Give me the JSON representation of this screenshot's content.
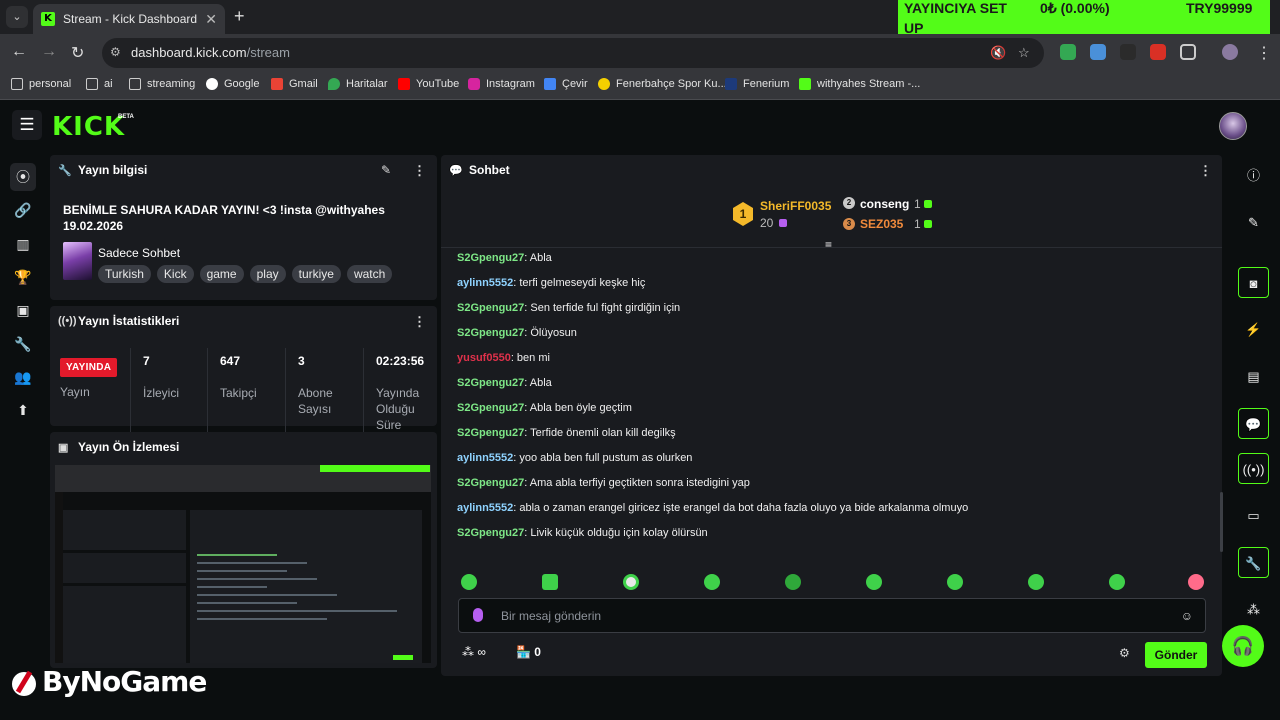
{
  "browser": {
    "tab_title": "Stream - Kick Dashboard",
    "tab_close": "✕",
    "new_tab": "+",
    "url_host": "dashboard.kick.com",
    "url_path": "/stream",
    "banner_1": "YAYINCIYA SET",
    "banner_1b": "UP",
    "banner_2": "0₺ (0.00%)",
    "banner_3": "TRY99999"
  },
  "bookmarks": [
    {
      "label": "personal",
      "icon": "folder-icon"
    },
    {
      "label": "ai",
      "icon": "folder-icon"
    },
    {
      "label": "streaming",
      "icon": "folder-icon"
    },
    {
      "label": "Google",
      "icon": "google-icon"
    },
    {
      "label": "Gmail",
      "icon": "gmail-icon"
    },
    {
      "label": "Haritalar",
      "icon": "maps-icon"
    },
    {
      "label": "YouTube",
      "icon": "youtube-icon"
    },
    {
      "label": "Instagram",
      "icon": "instagram-icon"
    },
    {
      "label": "Çevir",
      "icon": "translate-icon"
    },
    {
      "label": "Fenerbahçe Spor Ku...",
      "icon": "fenerbahce-icon"
    },
    {
      "label": "Fenerium",
      "icon": "fenerium-icon"
    },
    {
      "label": "withyahes Stream -...",
      "icon": "kick-icon"
    }
  ],
  "app": {
    "logo": "KICK",
    "beta": "BETA"
  },
  "stream_info": {
    "header": "Yayın bilgisi",
    "title_line1": "BENİMLE SAHURA KADAR YAYIN! <3 !insta @withyahes",
    "title_line2": "19.02.2026",
    "category": "Sadece Sohbet",
    "tags": [
      "Turkish",
      "Kick",
      "game",
      "play",
      "turkiye",
      "watch"
    ]
  },
  "stream_stats": {
    "header": "Yayın İstatistikleri",
    "live_badge": "YAYINDA",
    "live_label": "Yayın",
    "viewers_value": "7",
    "viewers_label": "İzleyici",
    "followers_value": "647",
    "followers_label": "Takipçi",
    "subs_value": "3",
    "subs_label_1": "Abone",
    "subs_label_2": "Sayısı",
    "duration_value": "02:23:56",
    "duration_label_1": "Yayında",
    "duration_label_2": "Olduğu",
    "duration_label_3": "Süre"
  },
  "preview": {
    "header": "Yayın Ön İzlemesi"
  },
  "chat": {
    "header": "Sohbet",
    "leader_1_name": "SheriFF0035",
    "leader_1_rank": "1",
    "leader_1_count": "20",
    "leader_2_name": "conseng",
    "leader_2_rank": "2",
    "leader_2_count": "1",
    "leader_3_name": "SEZ035",
    "leader_3_rank": "3",
    "leader_3_count": "1",
    "messages": [
      {
        "user": "S2Gpengu27",
        "color": "#7ee787",
        "text": ": Abla"
      },
      {
        "user": "aylinn5552",
        "color": "#8fd3ff",
        "text": ": terfi gelmeseydi keşke hiç"
      },
      {
        "user": "S2Gpengu27",
        "color": "#7ee787",
        "text": ": Sen terfide ful fight girdiğin için"
      },
      {
        "user": "S2Gpengu27",
        "color": "#7ee787",
        "text": ": Ölüyosun"
      },
      {
        "user": "yusuf0550",
        "color": "#e0314b",
        "text": ": ben mi"
      },
      {
        "user": "S2Gpengu27",
        "color": "#7ee787",
        "text": ": Abla"
      },
      {
        "user": "S2Gpengu27",
        "color": "#7ee787",
        "text": ": Abla ben öyle geçtim"
      },
      {
        "user": "S2Gpengu27",
        "color": "#7ee787",
        "text": ": Terfide önemli olan kill degilkş"
      },
      {
        "user": "aylinn5552",
        "color": "#8fd3ff",
        "text": ": yoo abla ben full pustum as olurken"
      },
      {
        "user": "S2Gpengu27",
        "color": "#7ee787",
        "text": ": Ama abla terfiyi geçtikten sonra istedigini yap"
      },
      {
        "user": "aylinn5552",
        "color": "#8fd3ff",
        "text": ": abla o zaman erangel giricez işte erangel da bot daha fazla oluyo ya bide arkalanma olmuyo"
      },
      {
        "user": "S2Gpengu27",
        "color": "#7ee787",
        "text": ": Livik küçük olduğu için kolay ölürsün"
      }
    ],
    "input_placeholder": "Bir mesaj gönderin",
    "points_value": "∞",
    "store_value": "0",
    "send_label": "Gönder"
  },
  "watermark": "ByNoGame",
  "colors": {
    "brand": "#53fc18",
    "live": "#e31a2b",
    "panel": "#191b1f",
    "background": "#0b0e0f"
  }
}
